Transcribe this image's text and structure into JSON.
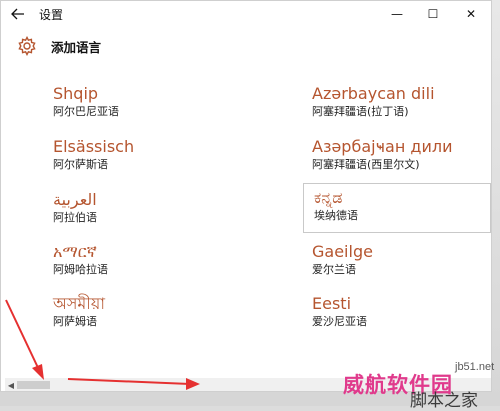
{
  "window": {
    "title": "设置",
    "back_icon": "back-arrow-icon",
    "controls": {
      "minimize": "—",
      "maximize": "☐",
      "close": "✕"
    }
  },
  "header": {
    "icon": "gear-icon",
    "title": "添加语言"
  },
  "languages": [
    {
      "name": "Shqip",
      "sub": "阿尔巴尼亚语"
    },
    {
      "name": "Elsässisch",
      "sub": "阿尔萨斯语"
    },
    {
      "name": "العربية",
      "sub": "阿拉伯语"
    },
    {
      "name": "አማርኛ",
      "sub": "阿姆哈拉语"
    },
    {
      "name": "অসমীয়া",
      "sub": "阿萨姆语"
    },
    {
      "name": "Azərbaycan dili",
      "sub": "阿塞拜疆语(拉丁语)"
    },
    {
      "name": "Азәрбајҹан дили",
      "sub": "阿塞拜疆语(西里尔文)"
    },
    {
      "name": "ಕನ್ನಡ",
      "sub": "埃纳德语"
    },
    {
      "name": "Gaeilge",
      "sub": "爱尔兰语"
    },
    {
      "name": "Eesti",
      "sub": "爱沙尼亚语"
    }
  ],
  "scrollbar": {
    "left_arrow": "◀"
  },
  "watermark": {
    "main": "威航软件园",
    "url": "jb51.net",
    "sub": "脚本之家"
  },
  "colors": {
    "accent": "#b5552f",
    "annotation_arrow": "#e53030"
  }
}
